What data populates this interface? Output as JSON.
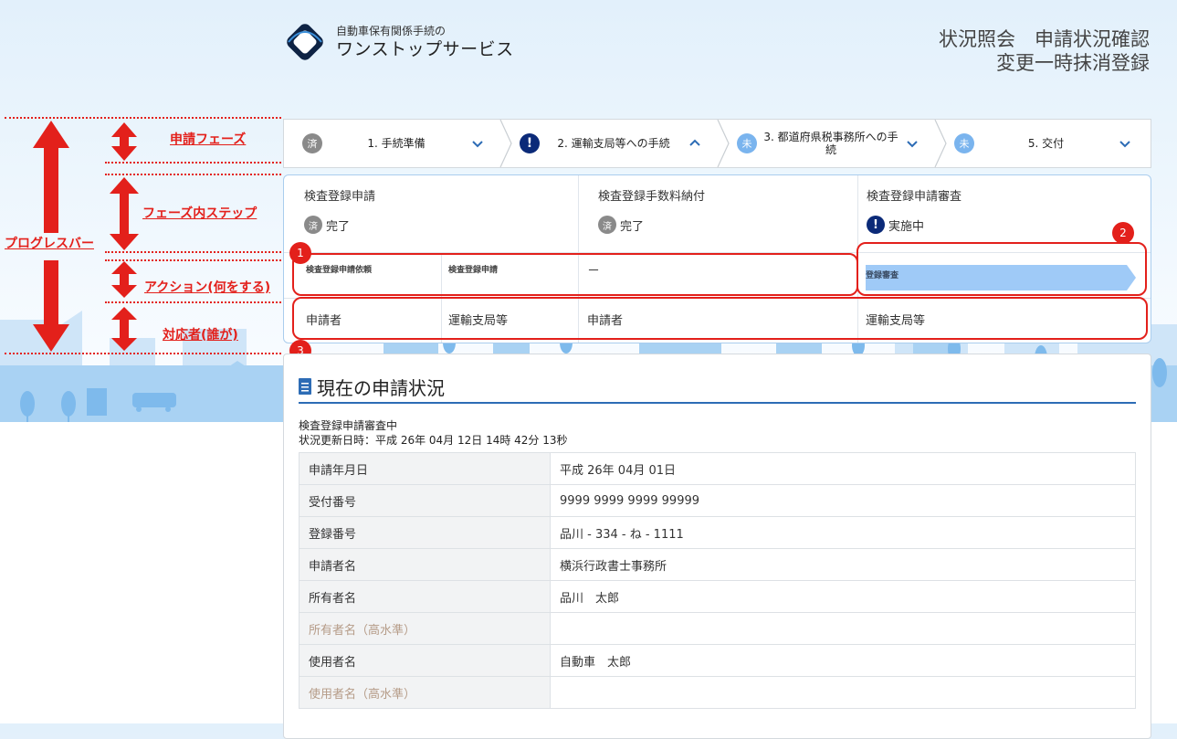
{
  "header": {
    "logo_line1": "自動車保有関係手続の",
    "logo_line2": "ワンストップサービス",
    "title_line1": "状況照会　申請状況確認",
    "title_line2": "変更一時抹消登録"
  },
  "phases": [
    {
      "badge": "済",
      "label": "1. 手続準備",
      "state": "done",
      "chevron": "chevron-down"
    },
    {
      "badge": "!",
      "label": "2. 運輸支局等への手続",
      "state": "current",
      "chevron": "chevron-up"
    },
    {
      "badge": "未",
      "label": "3. 都道府県税事務所への手続",
      "state": "todo",
      "chevron": "chevron-down"
    },
    {
      "badge": "未",
      "label": "5. 交付",
      "state": "todo",
      "chevron": "chevron-down"
    }
  ],
  "steps": [
    {
      "title": "検査登録申請",
      "status_badge": "済",
      "status": "完了"
    },
    {
      "title": "検査登録手数料納付",
      "status_badge": "済",
      "status": "完了"
    },
    {
      "title": "検査登録申請審査",
      "status_badge": "!",
      "status": "実施中"
    }
  ],
  "actions": {
    "a1": "検査登録申請依頼",
    "a2": "検査登録申請",
    "a3": "－",
    "a4": "登録審査"
  },
  "actors": {
    "p1": "申請者",
    "p2": "運輸支局等",
    "p3": "申請者",
    "p4": "運輸支局等"
  },
  "annotations": {
    "progress_bar": "プログレスバー",
    "phase": "申請フェーズ",
    "step": "フェーズ内ステップ",
    "action": "アクション(何をする)",
    "actor": "対応者(誰が)",
    "n1": "1",
    "n2": "2",
    "n3": "3"
  },
  "status_card": {
    "heading": "現在の申請状況",
    "state": "検査登録申請審査中",
    "updated": "状況更新日時：平成 26年 04月 12日 14時 42分 13秒",
    "rows": [
      {
        "key": "申請年月日",
        "value": "平成 26年 04月 01日",
        "muted": false
      },
      {
        "key": "受付番号",
        "value": "9999 9999 9999 99999",
        "muted": false
      },
      {
        "key": "登録番号",
        "value": "品川 - 334 - ね - 1111",
        "muted": false
      },
      {
        "key": "申請者名",
        "value": "横浜行政書士事務所",
        "muted": false
      },
      {
        "key": "所有者名",
        "value": "品川　太郎",
        "muted": false
      },
      {
        "key": "所有者名（高水準）",
        "value": "",
        "muted": true
      },
      {
        "key": "使用者名",
        "value": "自動車　太郎",
        "muted": false
      },
      {
        "key": "使用者名（高水準）",
        "value": "",
        "muted": true
      }
    ]
  },
  "colors": {
    "accent": "#0b2a78",
    "annotation_red": "#e3201b",
    "progress_arrow": "#9fcaf7",
    "heading_rule": "#2d6cb5"
  }
}
